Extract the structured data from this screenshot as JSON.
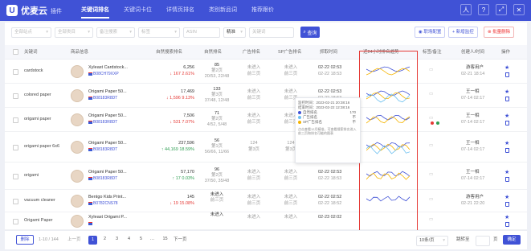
{
  "app": {
    "logo": "U",
    "name": "优麦云",
    "sub": "插件"
  },
  "nav": [
    "关键词排名",
    "关键词卡位",
    "详情页排名",
    "类别新品词",
    "推荐跟价"
  ],
  "window_buttons": [
    "人",
    "?",
    "⤢",
    "✕"
  ],
  "filters": {
    "site": "全部站点",
    "category": "全部类目",
    "remark": "备注搜索",
    "label": "标签",
    "asin": "ASIN",
    "sort_label": "精准",
    "keyword": "关键词",
    "query": "查询"
  },
  "actions": {
    "config": "职场配置",
    "add_monitor": "新增监控",
    "batch_delete": "批量删除"
  },
  "columns": [
    "关键词",
    "商品信息",
    "自然搜索排名",
    "自然排名",
    "广告排名",
    "SP广告排名",
    "抓取时间",
    "近24小时排名趋势",
    "标签/备注",
    "创建人/时间",
    "操作"
  ],
  "rows": [
    {
      "keyword": "cardstock",
      "title": "Xyleast Cardstock...",
      "asin": "B08CH79XXP",
      "org_rank": "6,256",
      "org_change": "↓ 167  2.61%",
      "org_dir": "down",
      "nat_rank": "85",
      "nat_sub1": "第2页",
      "nat_sub2": "20/53, 22/48",
      "ad_rank": "未进入",
      "ad_sub": "前三页",
      "sp_rank": "未进入",
      "sp_sub": "前三页",
      "time": "02-22 02:53",
      "time2": "02-22 18:53",
      "owner": "游客用户",
      "owner_time": "02-21 18:14"
    },
    {
      "keyword": "colored paper",
      "title": "Origami Paper 50...",
      "asin": "B08183R8DT",
      "org_rank": "17,469",
      "org_change": "↓ 1,596  9.13%",
      "org_dir": "down",
      "nat_rank": "133",
      "nat_sub1": "第3页",
      "nat_sub2": "37/48, 12/48",
      "ad_rank": "未进入",
      "ad_sub": "前三页",
      "sp_rank": "未进入",
      "sp_sub": "前三页",
      "time": "02-22 02:53",
      "time2": "02-22 18:53",
      "owner": "王一相",
      "owner_time": "07-14 02:17"
    },
    {
      "keyword": "origami paper",
      "title": "Origami Paper 50...",
      "asin": "B08183R8DT",
      "org_rank": "7,506",
      "org_change": "↓ 531  7.07%",
      "org_dir": "down",
      "nat_rank": "71",
      "nat_sub1": "第2页",
      "nat_sub2": "4/52, 5/48",
      "ad_rank": "未进入",
      "ad_sub": "前三页",
      "sp_rank": "未进入",
      "sp_sub": "前三页",
      "time": "02-22 02:53",
      "time2": "02-22 18:53",
      "owner": "王一相",
      "owner_time": "07-14 02:17"
    },
    {
      "keyword": "origami paper 6x6",
      "title": "Origami Paper 50...",
      "asin": "B08183R8DT",
      "org_rank": "237,596",
      "org_change": "↑ 44,169  18.59%",
      "org_dir": "up",
      "nat_rank": "56",
      "nat_sub1": "第1页",
      "nat_sub2": "56/66, 11/66",
      "ad_rank": "124",
      "ad_sub": "第3页",
      "sp_rank": "124",
      "sp_sub": "第3页",
      "sp_sub2": "5/66, 1/12",
      "time": "02-22 02:53",
      "time2": "02-22 18:53",
      "owner": "王一相",
      "owner_time": "07-14 02:17"
    },
    {
      "keyword": "origami",
      "title": "Origami Paper 50...",
      "asin": "B08183R8DT",
      "org_rank": "57,170",
      "org_change": "↑ 17  0.03%",
      "org_dir": "up",
      "nat_rank": "96",
      "nat_sub1": "第2页",
      "nat_sub2": "37/50, 35/48",
      "ad_rank": "未进入",
      "ad_sub": "前三页",
      "sp_rank": "未进入",
      "sp_sub": "前三页",
      "time": "02-22 02:53",
      "time2": "02-22 18:53",
      "owner": "王一相",
      "owner_time": "07-14 02:17"
    },
    {
      "keyword": "vacuum cleaner",
      "title": "Bentgo Kids Print...",
      "asin": "B0782CNS78",
      "org_rank": "145",
      "org_change": "↓ 19  15.08%",
      "org_dir": "down",
      "nat_rank": "未进入",
      "nat_sub1": "前三页",
      "nat_sub2": "",
      "ad_rank": "未进入",
      "ad_sub": "前三页",
      "sp_rank": "未进入",
      "sp_sub": "前三页",
      "time": "02-22 02:52",
      "time2": "02-22 18:52",
      "owner": "游客用户",
      "owner_time": "02-21 22:20"
    },
    {
      "keyword": "Origami Paper",
      "title": "Xyleast Origami P...",
      "asin": "",
      "org_rank": "",
      "org_change": "",
      "org_dir": "",
      "nat_rank": "未进入",
      "nat_sub1": "",
      "nat_sub2": "",
      "ad_rank": "未进入",
      "ad_sub": "",
      "sp_rank": "未进入",
      "sp_sub": "",
      "time": "02-23 02:02",
      "time2": "",
      "owner": "",
      "owner_time": ""
    }
  ],
  "tooltip": {
    "last_time_label": "监控时间：2023-02-21 20:38:16",
    "end_time_label": "结束时间：2023-02-22 12:38:16",
    "items": [
      {
        "name": "自然排名",
        "value": "170",
        "color": "#4052d6"
      },
      {
        "name": "广告排名",
        "value": "不",
        "color": "#6ec1f0"
      },
      {
        "name": "SP广告排名",
        "value": "不",
        "color": "#f5b400"
      }
    ],
    "note": "点击查看12月精准，可查看搜索排名进入前三页和排名可能的图表"
  },
  "footer": {
    "total_btn": "删除",
    "total_text": "1-10 / 144",
    "prev": "上一页",
    "pages": [
      "1",
      "2",
      "3",
      "4",
      "5",
      "…",
      "15"
    ],
    "next": "下一页",
    "page_size": "10条/页",
    "goto_label": "跳转至",
    "goto_unit": "页",
    "goto_btn": "确定"
  },
  "colors": {
    "accent": "#4052d6",
    "down": "#e53935",
    "up": "#2e9e52",
    "highlight_border": "#e53935"
  }
}
